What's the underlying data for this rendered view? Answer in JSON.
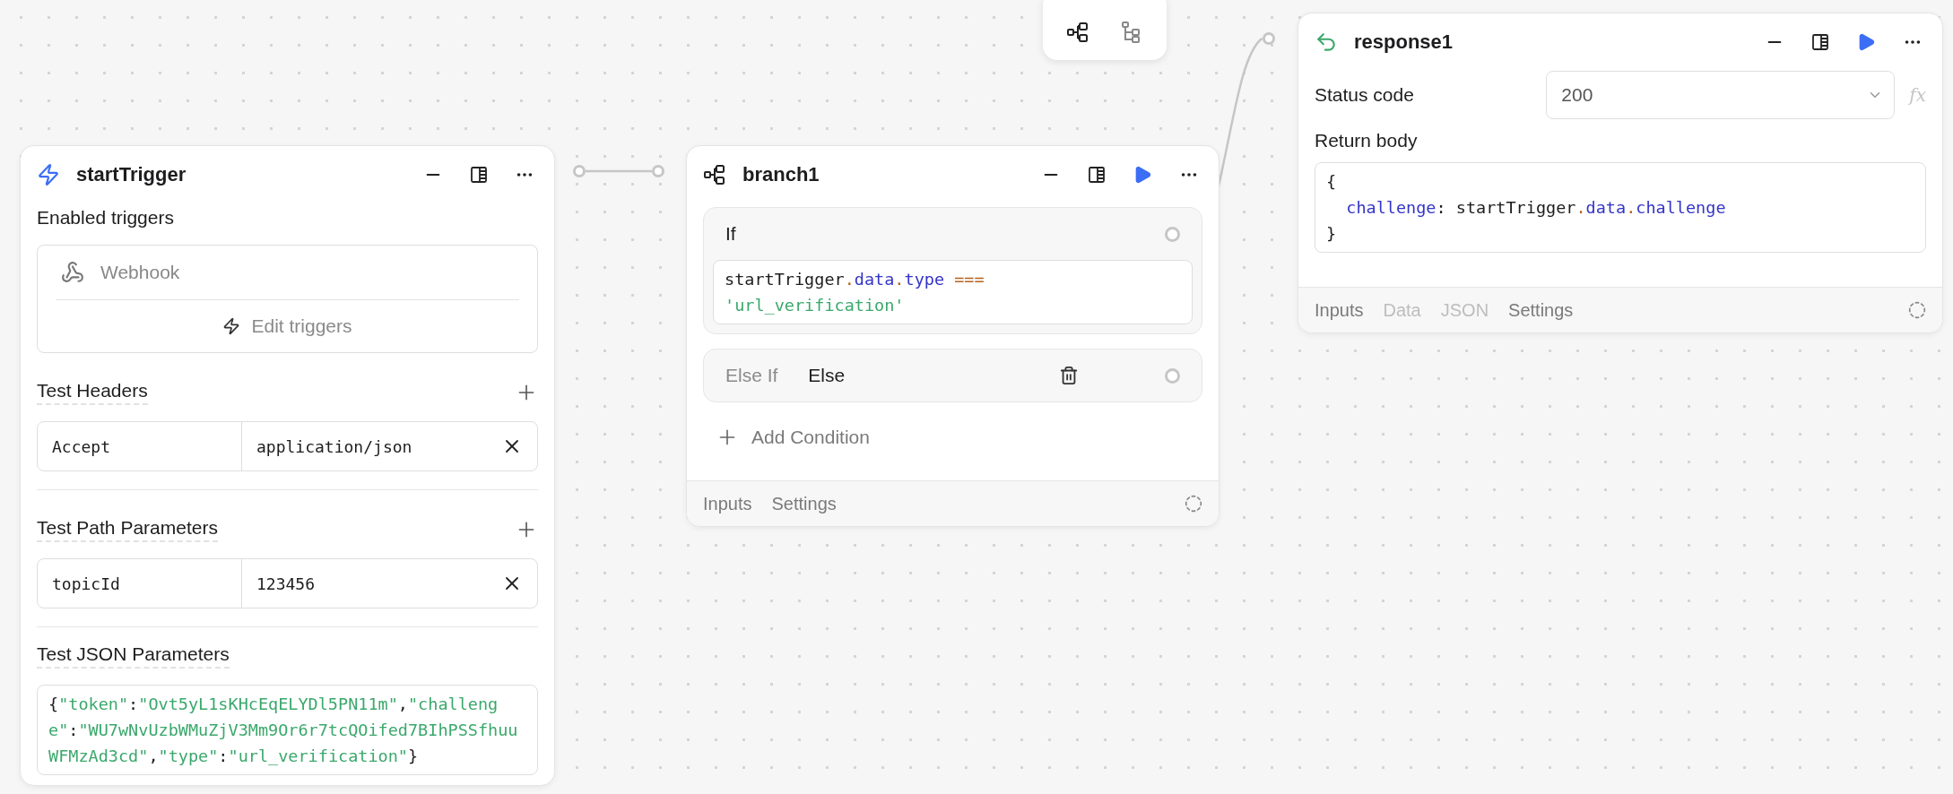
{
  "start_trigger": {
    "title": "startTrigger",
    "runnable": false,
    "enabled_triggers": {
      "label": "Enabled triggers",
      "items": [
        {
          "name": "Webhook"
        }
      ],
      "edit_label": "Edit triggers"
    },
    "param_groups": [
      {
        "label": "Test Headers",
        "rows": [
          {
            "key": "Accept",
            "value": "application/json"
          }
        ]
      },
      {
        "label": "Test Path Parameters",
        "rows": [
          {
            "key": "topicId",
            "value": "123456"
          }
        ]
      }
    ],
    "json_params": {
      "label": "Test JSON Parameters",
      "tokens": [
        {
          "kind": "plain",
          "text": "{"
        },
        {
          "kind": "string",
          "text": "\"token\""
        },
        {
          "kind": "plain",
          "text": ":"
        },
        {
          "kind": "string",
          "text": "\"Ovt5yL1sKHcEqELYDl5PN11m\""
        },
        {
          "kind": "plain",
          "text": ","
        },
        {
          "kind": "string",
          "text": "\"challenge\""
        },
        {
          "kind": "plain",
          "text": ":"
        },
        {
          "kind": "string",
          "text": "\"WU7wNvUzbWMuZjV3Mm9Or6r7tcQOifed7BIhPSSfhuuWFMzAd3cd\""
        },
        {
          "kind": "plain",
          "text": ","
        },
        {
          "kind": "string",
          "text": "\"type\""
        },
        {
          "kind": "plain",
          "text": ":"
        },
        {
          "kind": "string",
          "text": "\"url_verification\""
        },
        {
          "kind": "plain",
          "text": "}"
        }
      ]
    }
  },
  "branch": {
    "title": "branch1",
    "runnable": true,
    "conditions": [
      {
        "label": "If",
        "lines": [
          [
            {
              "kind": "plain",
              "text": "startTrigger"
            },
            {
              "kind": "operator",
              "text": "."
            },
            {
              "kind": "property",
              "text": "data"
            },
            {
              "kind": "operator",
              "text": "."
            },
            {
              "kind": "property",
              "text": "type"
            },
            {
              "kind": "operator",
              "text": "===",
              "space_before": true
            }
          ],
          [
            {
              "kind": "string",
              "text": "'url_verification'"
            }
          ]
        ]
      }
    ],
    "else": {
      "label": "Else If",
      "value": "Else"
    },
    "add_label": "Add Condition",
    "footer_tabs": [
      {
        "label": "Inputs",
        "disabled": false
      },
      {
        "label": "Settings",
        "disabled": false
      }
    ]
  },
  "response": {
    "title": "response1",
    "runnable": true,
    "status": {
      "label": "Status code",
      "value": "200",
      "formula_label": "fx"
    },
    "body": {
      "label": "Return body",
      "lines": [
        [
          {
            "kind": "plain",
            "text": "{"
          }
        ],
        [
          {
            "kind": "property",
            "text": "challenge",
            "indent": true
          },
          {
            "kind": "plain",
            "text": ": startTrigger"
          },
          {
            "kind": "operator",
            "text": "."
          },
          {
            "kind": "property",
            "text": "data"
          },
          {
            "kind": "operator",
            "text": "."
          },
          {
            "kind": "property",
            "text": "challenge"
          }
        ],
        [
          {
            "kind": "plain",
            "text": "}"
          }
        ]
      ]
    },
    "footer_tabs": [
      {
        "label": "Inputs",
        "disabled": false
      },
      {
        "label": "Data",
        "disabled": true
      },
      {
        "label": "JSON",
        "disabled": true
      },
      {
        "label": "Settings",
        "disabled": false
      }
    ]
  }
}
